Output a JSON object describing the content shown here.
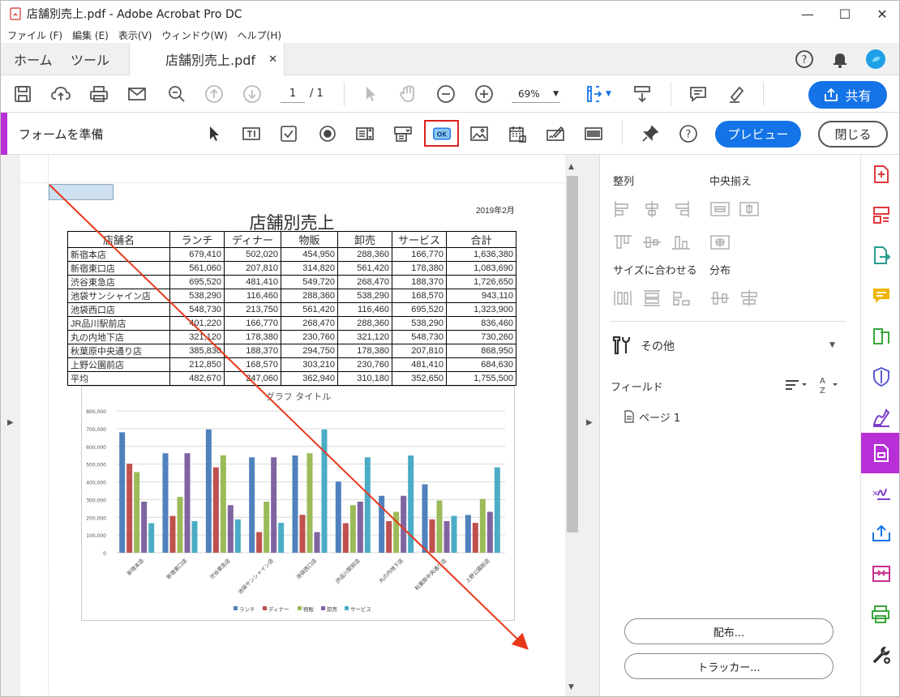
{
  "window": {
    "title": "店舗別売上.pdf - Adobe Acrobat Pro DC"
  },
  "menu": [
    "ファイル (F)",
    "編集 (E)",
    "表示(V)",
    "ウィンドウ(W)",
    "ヘルプ(H)"
  ],
  "tabs": {
    "home": "ホーム",
    "tools": "ツール",
    "doc": "店舗別売上.pdf"
  },
  "toolbar": {
    "page_current": "1",
    "page_total": "/ 1",
    "zoom": "69%",
    "share": "共有"
  },
  "formbar": {
    "title": "フォームを準備",
    "preview": "プレビュー",
    "close": "閉じる"
  },
  "document": {
    "date": "2019年2月",
    "title": "店舗別売上",
    "headers": [
      "店舗名",
      "ランチ",
      "ディナー",
      "物販",
      "卸売",
      "サービス",
      "合計"
    ],
    "rows": [
      [
        "新宿本店",
        "679,410",
        "502,020",
        "454,950",
        "288,360",
        "166,770",
        "1,636,380"
      ],
      [
        "新宿東口店",
        "561,060",
        "207,810",
        "314,820",
        "561,420",
        "178,380",
        "1,083,690"
      ],
      [
        "渋谷東急店",
        "695,520",
        "481,410",
        "549,720",
        "268,470",
        "188,370",
        "1,726,650"
      ],
      [
        "池袋サンシャイン店",
        "538,290",
        "116,460",
        "288,360",
        "538,290",
        "168,570",
        "943,110"
      ],
      [
        "池袋西口店",
        "548,730",
        "213,750",
        "561,420",
        "116,460",
        "695,520",
        "1,323,900"
      ],
      [
        "JR品川駅前店",
        "401,220",
        "166,770",
        "268,470",
        "288,360",
        "538,290",
        "836,460"
      ],
      [
        "丸の内地下店",
        "321,120",
        "178,380",
        "230,760",
        "321,120",
        "548,730",
        "730,260"
      ],
      [
        "秋葉原中央通り店",
        "385,830",
        "188,370",
        "294,750",
        "178,380",
        "207,810",
        "868,950"
      ],
      [
        "上野公園前店",
        "212,850",
        "168,570",
        "303,210",
        "230,760",
        "481,410",
        "684,630"
      ],
      [
        "平均",
        "482,670",
        "247,060",
        "362,940",
        "310,180",
        "352,650",
        "1,755,500"
      ]
    ]
  },
  "chart_data": {
    "type": "bar",
    "title": "グラフ タイトル",
    "categories": [
      "新宿本店",
      "新宿東口店",
      "渋谷東急店",
      "池袋サンシャイン店",
      "池袋西口店",
      "JR品川駅前店",
      "丸の内地下店",
      "秋葉原中央通り店",
      "上野公園前店"
    ],
    "series": [
      {
        "name": "ランチ",
        "color": "#4f81bd",
        "values": [
          679410,
          561060,
          695520,
          538290,
          548730,
          401220,
          321120,
          385830,
          212850
        ]
      },
      {
        "name": "ディナー",
        "color": "#c0504d",
        "values": [
          502020,
          207810,
          481410,
          116460,
          213750,
          166770,
          178380,
          188370,
          168570
        ]
      },
      {
        "name": "物販",
        "color": "#9bbb59",
        "values": [
          454950,
          314820,
          549720,
          288360,
          561420,
          268470,
          230760,
          294750,
          303210
        ]
      },
      {
        "name": "卸売",
        "color": "#8064a2",
        "values": [
          288360,
          561420,
          268470,
          538290,
          116460,
          288360,
          321120,
          178380,
          230760
        ]
      },
      {
        "name": "サービス",
        "color": "#4bacc6",
        "values": [
          166770,
          178380,
          188370,
          168570,
          695520,
          538290,
          548730,
          207810,
          481410
        ]
      }
    ],
    "yticks": [
      "800,000",
      "700,000",
      "600,000",
      "500,000",
      "400,000",
      "300,000",
      "200,000",
      "100,000",
      "0"
    ],
    "ylim": [
      0,
      800000
    ],
    "grid": true,
    "legend": "bottom"
  },
  "rightpanel": {
    "align": "整列",
    "center": "中央揃え",
    "fit": "サイズに合わせる",
    "distribute": "分布",
    "other": "その他",
    "fields": "フィールド",
    "page": "ページ 1",
    "distribute_btn": "配布...",
    "tracker_btn": "トラッカー..."
  },
  "colors": {
    "accent": "#1473e6",
    "form_accent": "#b72fd6",
    "arrow": "#e8381a",
    "highlight": "#e02020"
  }
}
